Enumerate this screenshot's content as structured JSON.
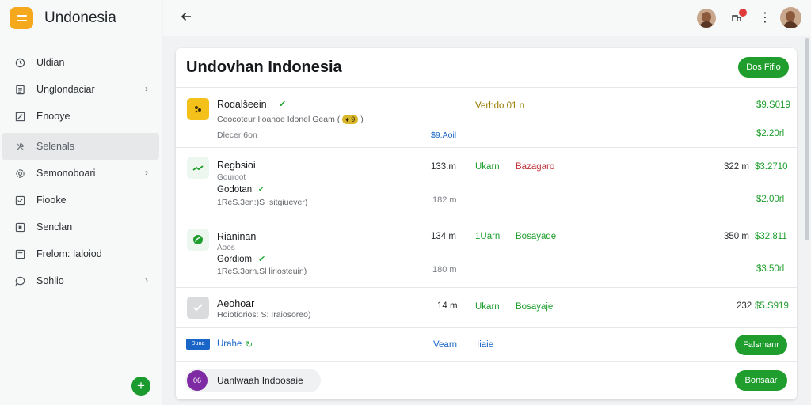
{
  "app": {
    "name": "Undonesia"
  },
  "sidebar": {
    "items": [
      {
        "label": "Uldian",
        "icon": "clock-icon",
        "chevron": false
      },
      {
        "label": "Unglondaciar",
        "icon": "document-icon",
        "chevron": true
      },
      {
        "label": "Enooye",
        "icon": "edit-icon",
        "chevron": false
      },
      {
        "label": "Selenals",
        "icon": "tools-icon",
        "chevron": false,
        "active": true
      },
      {
        "label": "Semonoboari",
        "icon": "gear-icon",
        "chevron": true
      },
      {
        "label": "Fiooke",
        "icon": "checkbox-icon",
        "chevron": false
      },
      {
        "label": "Senclan",
        "icon": "square-icon",
        "chevron": false
      },
      {
        "label": "Frelom: Ialoiod",
        "icon": "note-icon",
        "chevron": false
      },
      {
        "label": "Sohlio",
        "icon": "chat-icon",
        "chevron": true
      }
    ],
    "fab_label": "+"
  },
  "topbar": {
    "back_icon": "back-arrow-icon",
    "kebab": "⋮"
  },
  "main": {
    "title": "Undovhan Indonesia",
    "header_button": "Dos Fifio",
    "rows": [
      {
        "icon": "tag-icon",
        "name": "Rodalšeein",
        "sub": "Ceocoteur Iioanoe Idonel Geam (",
        "badge": "♦ 9",
        "sub_tail": ")",
        "meta": "Dlecer 6on",
        "meta_value": "$9.Aoil",
        "status": "Verhdo 01 n",
        "amount_top": "$9.S019",
        "amount_bottom": "$2.20rl"
      },
      {
        "icon": "trend-icon",
        "name": "Regbsioi",
        "sub": "Gouroot",
        "line2": "Godotan",
        "line3": "1ReS.3en:)S Isitgiuever)",
        "qty_top": "133.m",
        "qty_bottom": "182 m",
        "col_a": "Ukarn",
        "col_b": "Bazagaro",
        "amount_left": "322 m",
        "amount_top": "$3.2710",
        "amount_bottom": "$2.00rl"
      },
      {
        "icon": "leaf-icon",
        "name": "Rianinan",
        "sub": "Aoos",
        "line2": "Gordiom",
        "line3": "1ReS.3orn,Sl liriosteuin)",
        "qty_top": "134 m",
        "qty_bottom": "180 m",
        "col_a": "1Uarn",
        "col_b": "Bosayade",
        "amount_left": "350 m",
        "amount_top": "$32.811",
        "amount_bottom": "$3.50rl"
      },
      {
        "icon": "check-icon",
        "name": "Aeohoar",
        "sub": "Hoiotiorios: S: Iraiosoreo)",
        "qty_top": "14 m",
        "col_a": "Ukarn",
        "col_b": "Bosayaje",
        "amount_left": "232",
        "amount_top": "$5.S919"
      }
    ],
    "summary_row": {
      "tag": "Duna",
      "name": "Urahe",
      "col_a": "Vearn",
      "col_b": "Iiaie",
      "button": "Falsmanr"
    },
    "footer": {
      "avatar_text": "06",
      "label": "Uanlwaah Indoosaie",
      "button": "Bonsaar"
    }
  },
  "colors": {
    "accent_green": "#1f9e2e",
    "brand_orange": "#f6a81c",
    "link_blue": "#1a66c8",
    "alert_red": "#c0343a",
    "warn_olive": "#9a7a00"
  }
}
